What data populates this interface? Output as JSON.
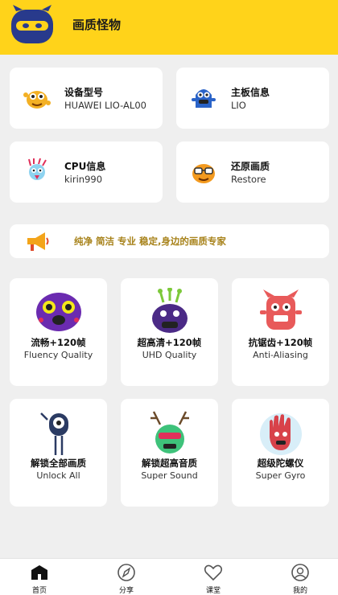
{
  "header": {
    "title": "画质怪物"
  },
  "info_cards": [
    {
      "title": "设备型号",
      "value": "HUAWEI LIO-AL00"
    },
    {
      "title": "主板信息",
      "value": "LIO"
    },
    {
      "title": "CPU信息",
      "value": "kirin990"
    },
    {
      "title": "还原画质",
      "value": "Restore"
    }
  ],
  "slogan": "纯净 简洁 专业 稳定,身边的画质专家",
  "features": [
    {
      "cn": "流畅+120帧",
      "en": "Fluency Quality"
    },
    {
      "cn": "超高清+120帧",
      "en": "UHD Quality"
    },
    {
      "cn": "抗锯齿+120帧",
      "en": "Anti-Aliasing"
    },
    {
      "cn": "解锁全部画质",
      "en": "Unlock All"
    },
    {
      "cn": "解锁超高音质",
      "en": "Super Sound"
    },
    {
      "cn": "超级陀螺仪",
      "en": "Super Gyro"
    }
  ],
  "tabs": [
    {
      "label": "首页",
      "icon": "home-icon"
    },
    {
      "label": "分享",
      "icon": "compass-icon"
    },
    {
      "label": "课堂",
      "icon": "heart-icon"
    },
    {
      "label": "我的",
      "icon": "user-icon"
    }
  ],
  "colors": {
    "brand_yellow": "#ffd31a",
    "slogan_text": "#a7821a",
    "background": "#efefef"
  }
}
